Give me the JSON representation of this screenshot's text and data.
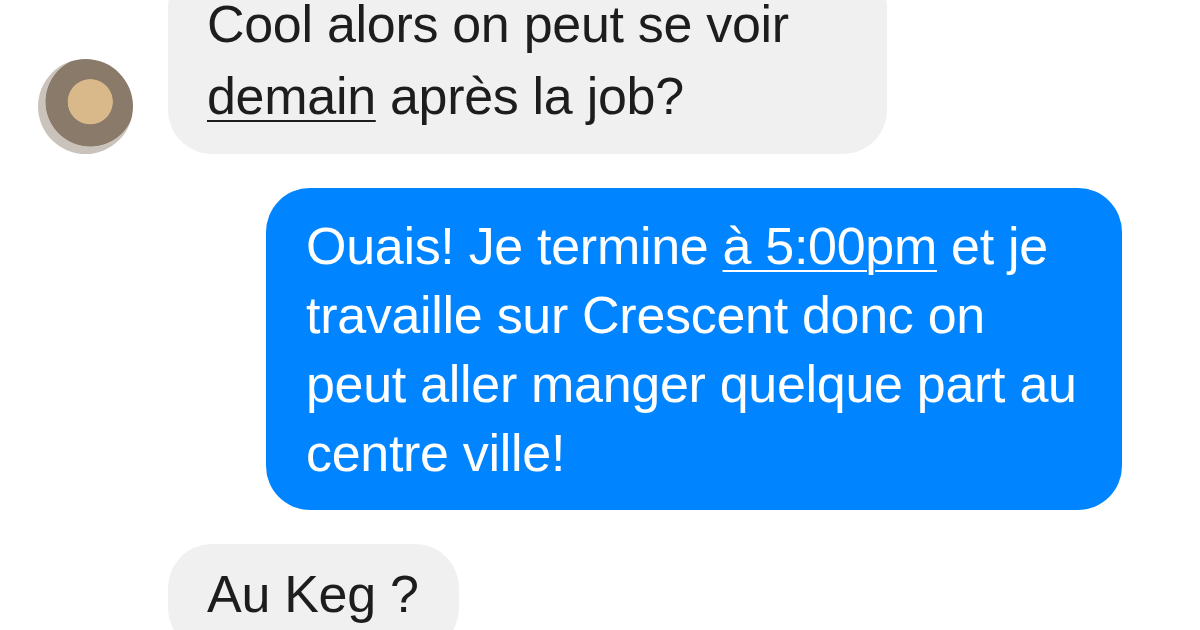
{
  "messages": [
    {
      "kind": "incoming",
      "avatar": true,
      "parts": [
        {
          "kind": "text",
          "text": "Cool alors on peut se voir "
        },
        {
          "kind": "link",
          "text": "demain"
        },
        {
          "kind": "text",
          "text": " après la job?"
        }
      ]
    },
    {
      "kind": "outgoing",
      "avatar": false,
      "parts": [
        {
          "kind": "text",
          "text": "Ouais! Je termine "
        },
        {
          "kind": "link",
          "text": "à 5:00pm"
        },
        {
          "kind": "text",
          "text": " et je travaille sur Crescent donc on peut aller manger quelque part au centre ville!"
        }
      ]
    },
    {
      "kind": "incoming",
      "avatar": false,
      "parts": [
        {
          "kind": "text",
          "text": "Au Keg ?"
        }
      ]
    }
  ]
}
